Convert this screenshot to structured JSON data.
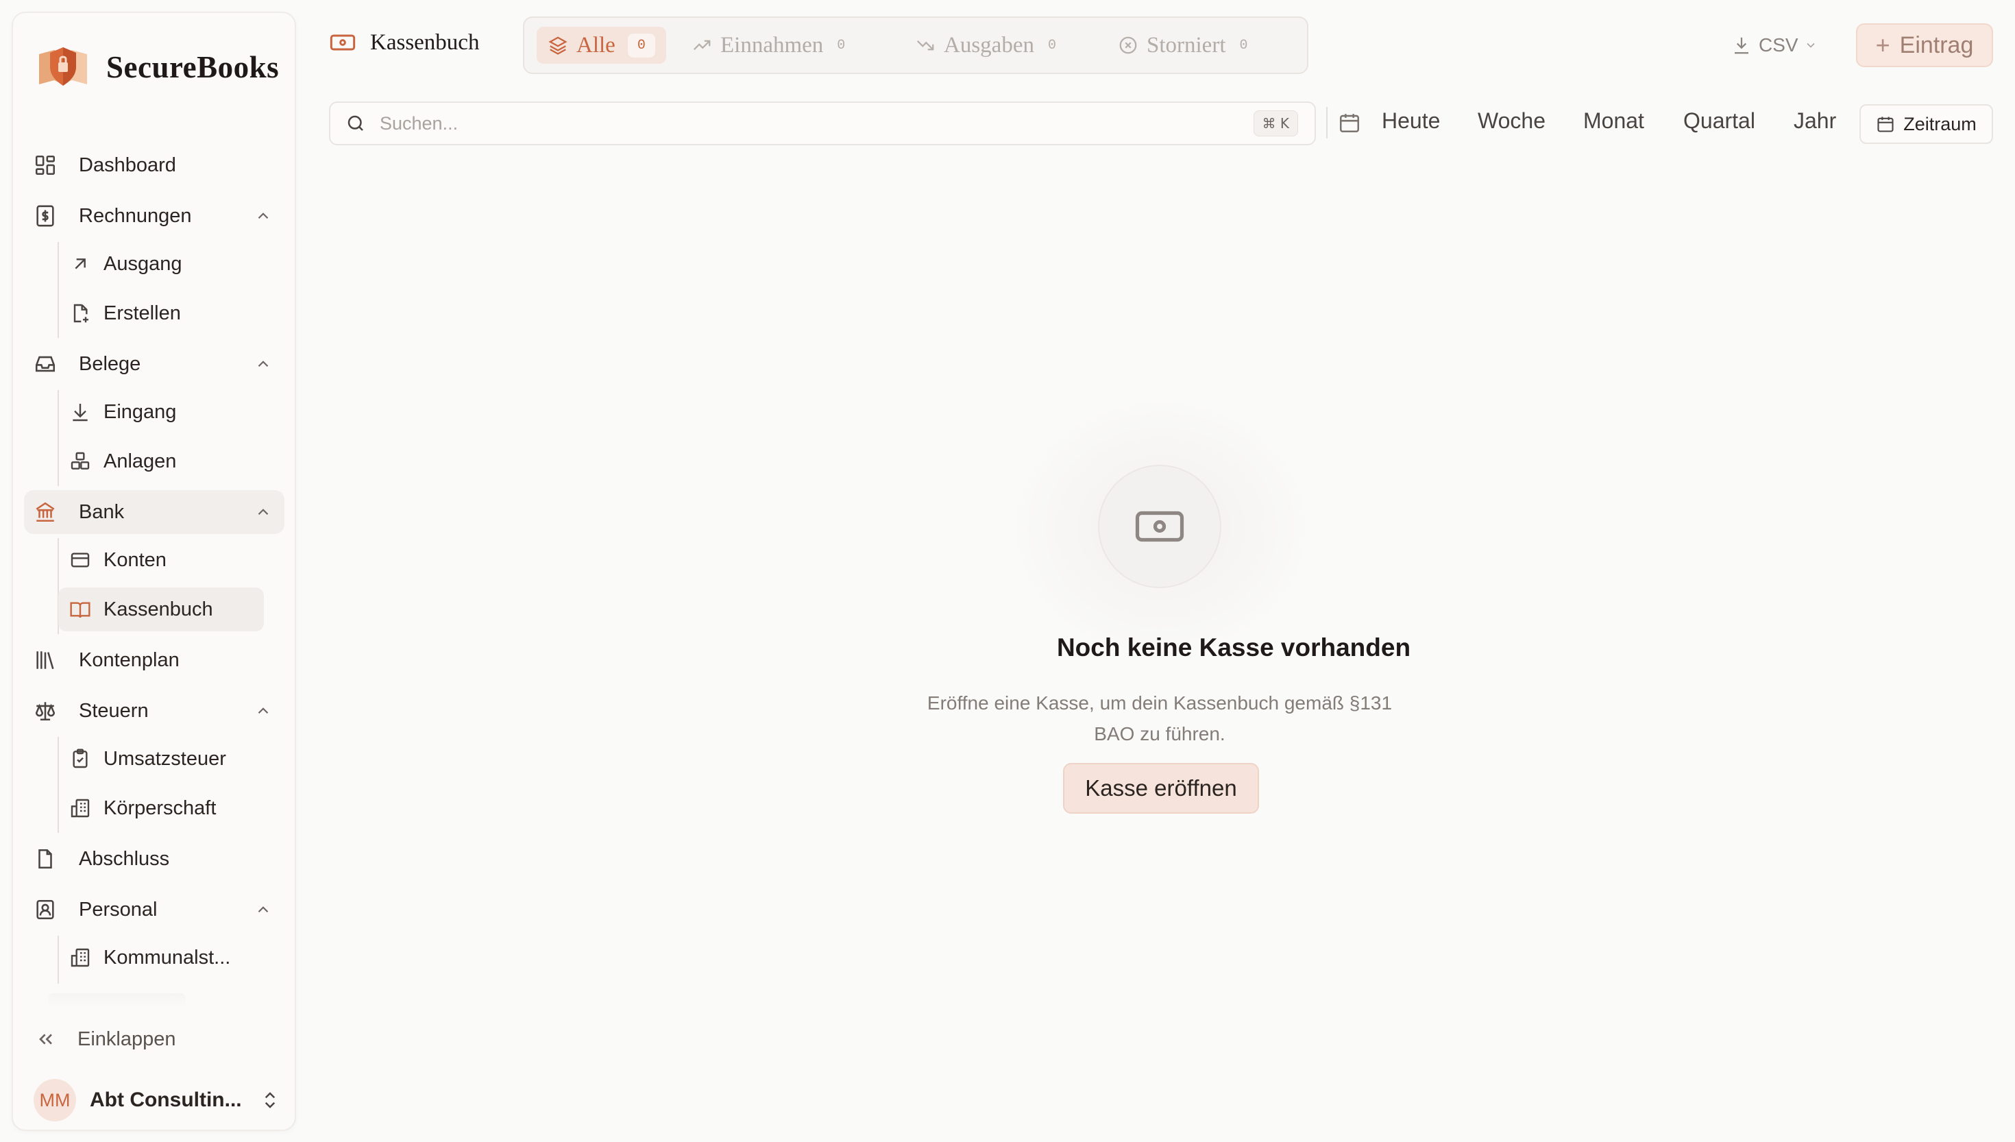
{
  "brand": {
    "name": "SecureBooks"
  },
  "sidebar": {
    "items": [
      {
        "label": "Dashboard"
      },
      {
        "label": "Rechnungen",
        "children": [
          "Ausgang",
          "Erstellen"
        ]
      },
      {
        "label": "Belege",
        "children": [
          "Eingang",
          "Anlagen"
        ]
      },
      {
        "label": "Bank",
        "children": [
          "Konten",
          "Kassenbuch"
        ]
      },
      {
        "label": "Kontenplan"
      },
      {
        "label": "Steuern",
        "children": [
          "Umsatzsteuer",
          "Körperschaft"
        ]
      },
      {
        "label": "Abschluss"
      },
      {
        "label": "Personal",
        "children": [
          "Kommunalst..."
        ]
      }
    ],
    "collapse_label": "Einklappen",
    "profile": {
      "initials": "MM",
      "name": "Abt Consultin..."
    }
  },
  "header": {
    "title": "Kassenbuch",
    "tabs": [
      {
        "label": "Alle",
        "count": "0",
        "active": true
      },
      {
        "label": "Einnahmen",
        "count": "0"
      },
      {
        "label": "Ausgaben",
        "count": "0"
      },
      {
        "label": "Storniert",
        "count": "0"
      }
    ],
    "csv_label": "CSV",
    "entry_label": "Eintrag"
  },
  "search": {
    "placeholder": "Suchen...",
    "shortcut": "⌘ K"
  },
  "ranges": [
    "Heute",
    "Woche",
    "Monat",
    "Quartal",
    "Jahr"
  ],
  "period_label": "Zeitraum",
  "empty": {
    "title": "Noch keine Kasse vorhanden",
    "description": "Eröffne eine Kasse, um dein Kassenbuch gemäß §131 BAO zu führen.",
    "button": "Kasse eröffnen"
  },
  "colors": {
    "accent": "#c8653f",
    "accent_soft": "#f6e4dc",
    "background": "#fafaf9"
  }
}
